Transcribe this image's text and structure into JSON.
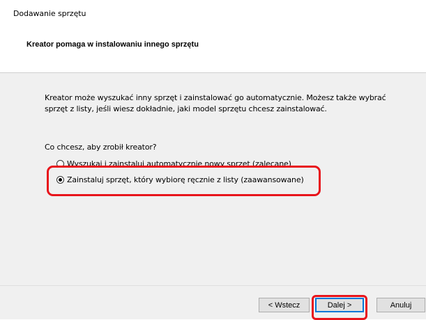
{
  "window": {
    "title": "Dodawanie sprzętu"
  },
  "header": {
    "title": "Kreator pomaga w instalowaniu innego sprzętu"
  },
  "body": {
    "intro_line1": "Kreator może wyszukać inny sprzęt i zainstalować go automatycznie. Możesz także wybrać",
    "intro_line2": "sprzęt z listy, jeśli wiesz dokładnie, jaki model sprzętu chcesz zainstalować.",
    "question": "Co chcesz, aby zrobił kreator?",
    "options": [
      {
        "label": "Wyszukaj i zainstaluj automatycznie nowy sprzęt (zalecane)",
        "selected": false
      },
      {
        "label": "Zainstaluj sprzęt, który wybiorę ręcznie z listy (zaawansowane)",
        "selected": true
      }
    ]
  },
  "buttons": {
    "back": "< Wstecz",
    "next": "Dalej >",
    "cancel": "Anuluj"
  },
  "highlight_color": "#e8141b",
  "focus_color": "#0078d7"
}
